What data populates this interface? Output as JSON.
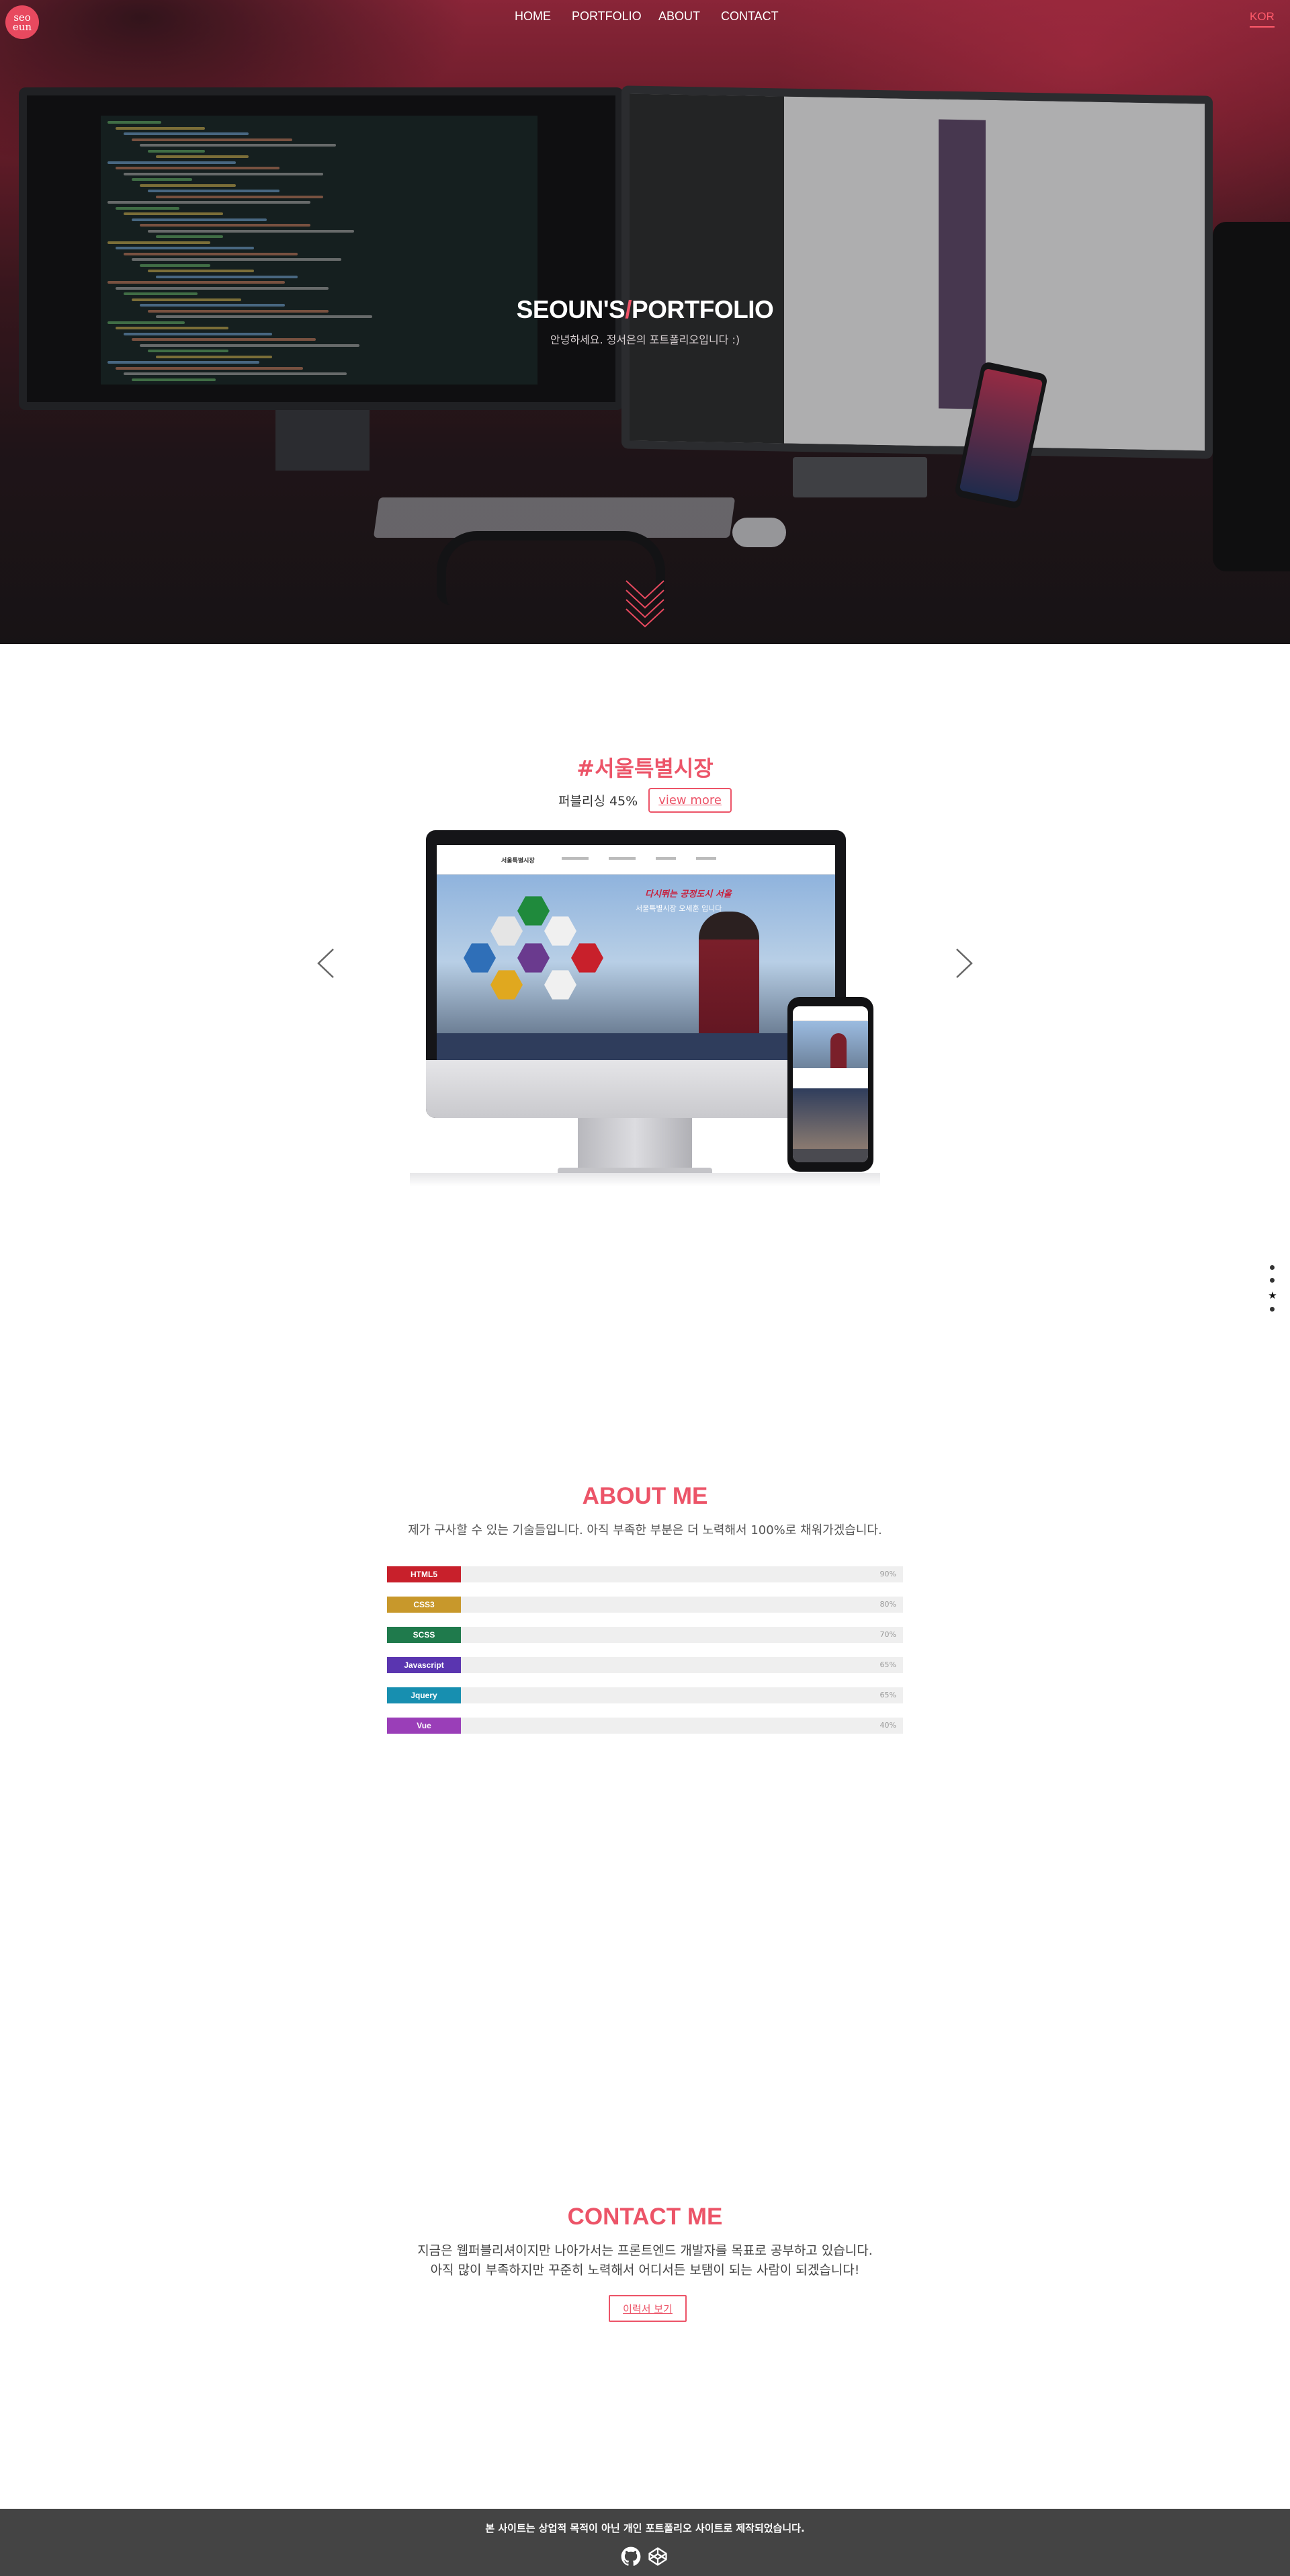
{
  "logo": {
    "line1": "seo",
    "line2": "eun"
  },
  "nav": {
    "items": [
      "HOME",
      "PORTFOLIO",
      "ABOUT",
      "CONTACT"
    ],
    "lang": "KOR"
  },
  "hero": {
    "title_main": "SEOUN'S",
    "title_slash": "/",
    "title_end": "PORTFOLIO",
    "subtitle": "안녕하세요. 정서은의 포트폴리오입니다 :)"
  },
  "portfolio": {
    "title": "#서울특별시장",
    "publishing": "퍼블리싱 45%",
    "view_more": "view more",
    "site_text": {
      "brand": "서울특별시장",
      "slogan_1": "다시뛰는 공정도시 서울",
      "slogan_2": "서울특별시장 오세훈 입니다"
    },
    "pagination": {
      "count": 4,
      "active": 3
    }
  },
  "about": {
    "title": "ABOUT ME",
    "subtitle": "제가 구사할 수 있는 기술들입니다. 아직 부족한 부분은 더 노력해서 100%로 채워가겠습니다.",
    "skills": [
      {
        "name": "HTML5",
        "percent": "90%",
        "color": "#c8202b"
      },
      {
        "name": "CSS3",
        "percent": "80%",
        "color": "#c8982b"
      },
      {
        "name": "SCSS",
        "percent": "70%",
        "color": "#1f7a4c"
      },
      {
        "name": "Javascript",
        "percent": "65%",
        "color": "#5a35b0"
      },
      {
        "name": "Jquery",
        "percent": "65%",
        "color": "#178fb0"
      },
      {
        "name": "Vue",
        "percent": "40%",
        "color": "#9a3eb8"
      }
    ]
  },
  "contact": {
    "title": "CONTACT ME",
    "line1": "지금은 웹퍼블리셔이지만 나아가서는 프론트엔드 개발자를 목표로 공부하고 있습니다.",
    "line2": "아직 많이 부족하지만 꾸준히 노력해서 어디서든 보탬이 되는 사람이 되겠습니다!",
    "resume_button": "이력서 보기"
  },
  "footer": {
    "text": "본 사이트는 상업적 목적이 아닌 개인 포트폴리오 사이트로 제작되었습니다.",
    "icons": [
      "github-icon",
      "codepen-icon"
    ]
  },
  "colors": {
    "accent": "#ec5468",
    "footer_bg": "#444444"
  }
}
